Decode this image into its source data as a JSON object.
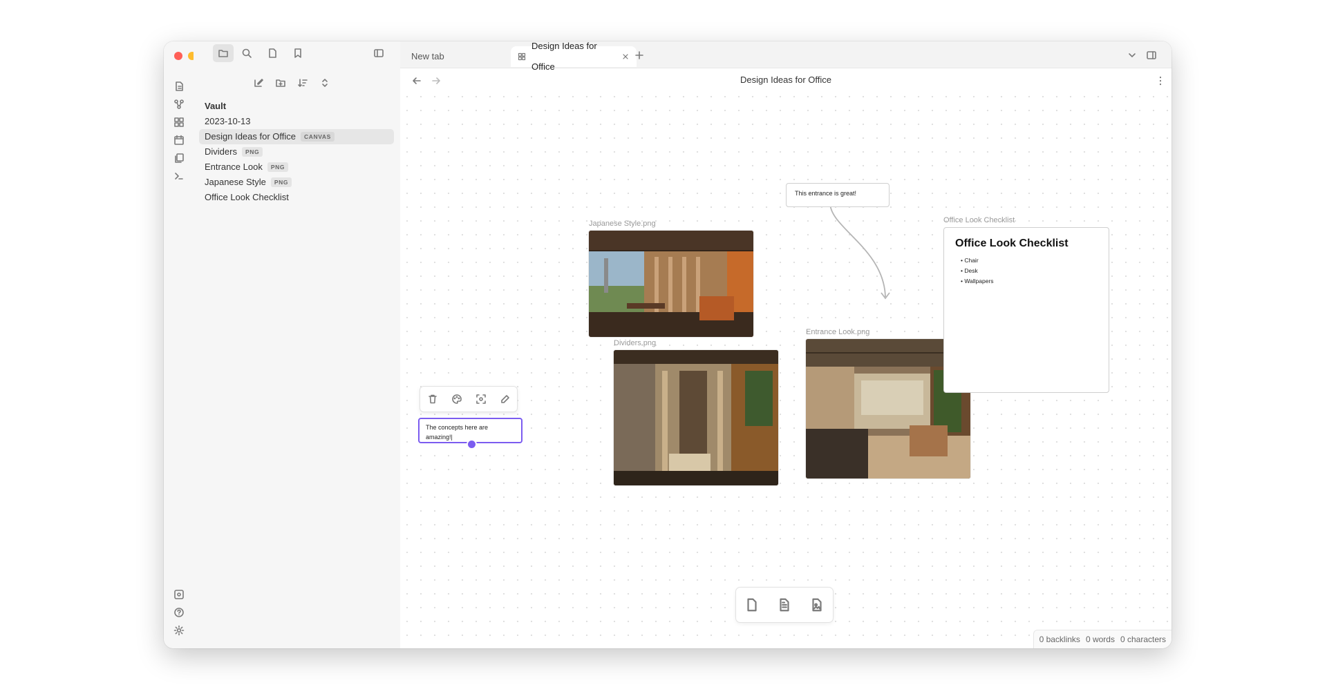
{
  "tabs": {
    "new_tab": "New tab",
    "active": "Design Ideas for Office"
  },
  "header": {
    "title": "Design Ideas for Office"
  },
  "vault": {
    "name": "Vault",
    "items": [
      {
        "label": "2023-10-13",
        "badge": ""
      },
      {
        "label": "Design Ideas for Office",
        "badge": "CANVAS"
      },
      {
        "label": "Dividers",
        "badge": "PNG"
      },
      {
        "label": "Entrance Look",
        "badge": "PNG"
      },
      {
        "label": "Japanese Style",
        "badge": "PNG"
      },
      {
        "label": "Office Look Checklist",
        "badge": ""
      }
    ]
  },
  "canvas": {
    "japanese": {
      "label": "Japanese Style.png"
    },
    "dividers": {
      "label": "Dividers.png"
    },
    "entrance": {
      "label": "Entrance Look.png"
    },
    "entrance_note": "This entrance is great!",
    "checklist": {
      "label": "Office Look Checklist",
      "title": "Office Look Checklist",
      "items": [
        "Chair",
        "Desk",
        "Wallpapers"
      ]
    },
    "editing_note": "The concepts here are amazing!|"
  },
  "status": {
    "backlinks": "0 backlinks",
    "words": "0 words",
    "characters": "0 characters"
  },
  "colors": {
    "accent": "#7b5cf0",
    "close": "#ff5f57",
    "minimize": "#febc2e",
    "zoom": "#28c840"
  }
}
